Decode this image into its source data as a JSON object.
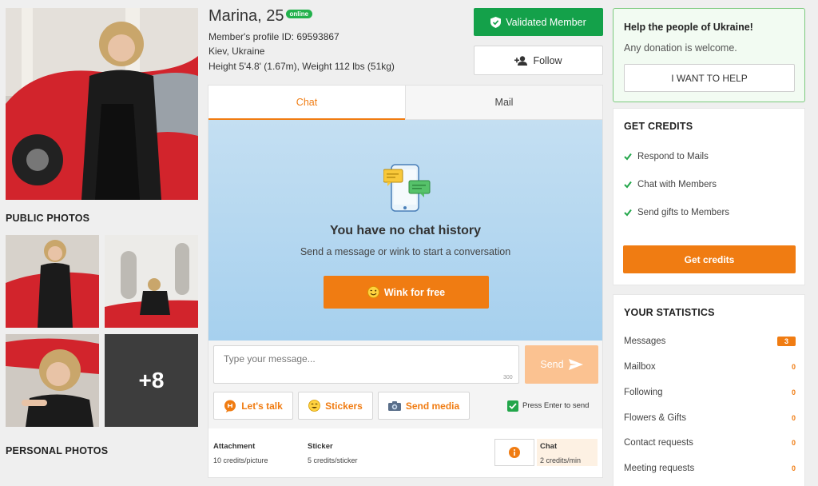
{
  "profile": {
    "name": "Marina, 25",
    "online_label": "online",
    "profile_id": "Member's profile ID: 69593867",
    "location": "Kiev, Ukraine",
    "body": "Height 5'4.8' (1.67m), Weight 112 lbs (51kg)",
    "validated_label": "Validated Member",
    "follow_label": "Follow"
  },
  "photos": {
    "public_title": "PUBLIC PHOTOS",
    "personal_title": "PERSONAL PHOTOS",
    "more_count": "+8"
  },
  "chat": {
    "tabs": [
      {
        "label": "Chat",
        "active": true
      },
      {
        "label": "Mail",
        "active": false
      }
    ],
    "empty_title": "You have no chat history",
    "empty_subtitle": "Send a message or wink to start a conversation",
    "wink_label": "Wink for free",
    "input_placeholder": "Type your message...",
    "char_limit": "300",
    "send_label": "Send",
    "tools": [
      {
        "label": "Let's talk",
        "icon": "speech-icon"
      },
      {
        "label": "Stickers",
        "icon": "sticker-icon"
      },
      {
        "label": "Send media",
        "icon": "camera-icon"
      }
    ],
    "press_enter_label": "Press Enter to send",
    "press_enter_checked": true
  },
  "costs": {
    "attachment_title": "Attachment",
    "attachment_value": "10 credits/picture",
    "sticker_title": "Sticker",
    "sticker_value": "5 credits/sticker",
    "chat_title": "Chat",
    "chat_value": "2 credits/min"
  },
  "ukraine": {
    "title": "Help the people of Ukraine!",
    "subtitle": "Any donation is welcome.",
    "button_label": "I WANT TO HELP"
  },
  "credits": {
    "title": "GET CREDITS",
    "items": [
      "Respond to Mails",
      "Chat with Members",
      "Send gifts to Members"
    ],
    "button_label": "Get credits"
  },
  "stats": {
    "title": "YOUR STATISTICS",
    "rows": [
      {
        "label": "Messages",
        "count": "3",
        "highlight": true
      },
      {
        "label": "Mailbox",
        "count": "0"
      },
      {
        "label": "Following",
        "count": "0"
      },
      {
        "label": "Flowers & Gifts",
        "count": "0"
      },
      {
        "label": "Contact requests",
        "count": "0"
      },
      {
        "label": "Meeting requests",
        "count": "0"
      }
    ]
  },
  "colors": {
    "accent": "#f07c12",
    "validated": "#14a14a",
    "online": "#22b14c",
    "chat_bg": "#a6d0ee"
  }
}
